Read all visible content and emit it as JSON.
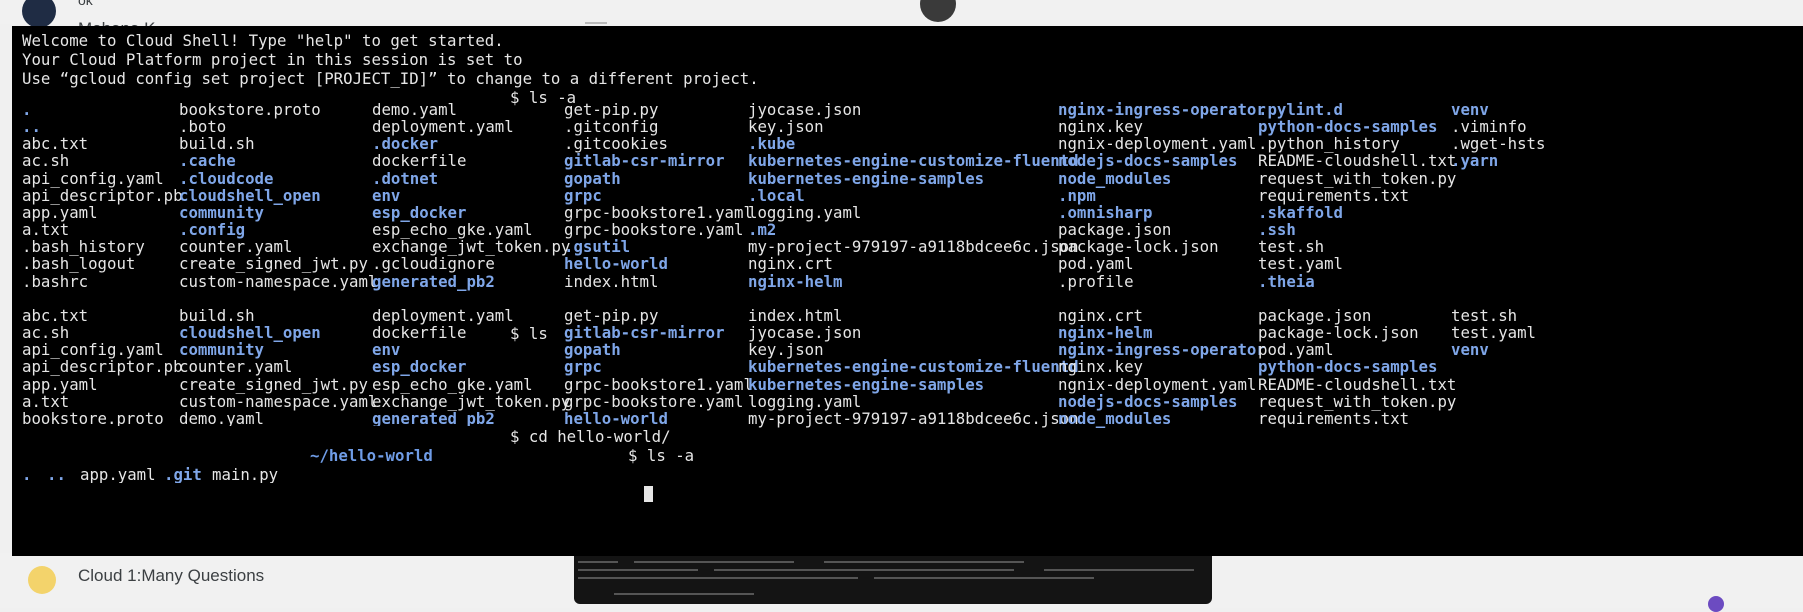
{
  "background": {
    "sender_initials": "ok",
    "sender_name": "Mohana K",
    "bottom_label": "Cloud 1:Many Questions"
  },
  "terminal": {
    "welcome": [
      "Welcome to Cloud Shell! Type \"help\" to get started.",
      "Your Cloud Platform project in this session is set to",
      "Use “gcloud config set project [PROJECT_ID]” to change to a different project."
    ],
    "commands": {
      "ls_a": "$ ls -a",
      "ls": "$ ls",
      "cd": "$ cd hello-world/",
      "ls_a2": "$ ls -a"
    },
    "prompt_path": "~/hello-world",
    "listing1": [
      [
        ".",
        "bookstore.proto",
        "demo.yaml",
        "get-pip.py",
        "jyocase.json",
        "nginx-ingress-operator",
        ".pylint.d",
        "venv"
      ],
      [
        "..",
        ".boto",
        "deployment.yaml",
        ".gitconfig",
        "key.json",
        "nginx.key",
        "python-docs-samples",
        ".viminfo"
      ],
      [
        "abc.txt",
        "build.sh",
        ".docker",
        ".gitcookies",
        ".kube",
        "ngnix-deployment.yaml",
        ".python_history",
        ".wget-hsts"
      ],
      [
        "ac.sh",
        ".cache",
        "dockerfile",
        "gitlab-csr-mirror",
        "kubernetes-engine-customize-fluentd",
        "nodejs-docs-samples",
        "README-cloudshell.txt",
        ".yarn"
      ],
      [
        "api_config.yaml",
        ".cloudcode",
        ".dotnet",
        "gopath",
        "kubernetes-engine-samples",
        "node_modules",
        "request_with_token.py",
        ""
      ],
      [
        "api_descriptor.pb",
        "cloudshell_open",
        "env",
        "grpc",
        ".local",
        ".npm",
        "requirements.txt",
        ""
      ],
      [
        "app.yaml",
        "community",
        "esp_docker",
        "grpc-bookstore1.yaml",
        "logging.yaml",
        ".omnisharp",
        ".skaffold",
        ""
      ],
      [
        "a.txt",
        ".config",
        "esp_echo_gke.yaml",
        "grpc-bookstore.yaml",
        ".m2",
        "package.json",
        ".ssh",
        ""
      ],
      [
        ".bash_history",
        "counter.yaml",
        "exchange_jwt_token.py",
        ".gsutil",
        "my-project-979197-a9118bdcee6c.json",
        "package-lock.json",
        "test.sh",
        ""
      ],
      [
        ".bash_logout",
        "create_signed_jwt.py",
        ".gcloudignore",
        "hello-world",
        "nginx.crt",
        "pod.yaml",
        "test.yaml",
        ""
      ],
      [
        ".bashrc",
        "custom-namespace.yaml",
        "generated_pb2",
        "index.html",
        "nginx-helm",
        ".profile",
        ".theia",
        ""
      ]
    ],
    "listing1_dirs": [
      [
        1,
        0,
        0,
        0,
        0,
        1,
        1,
        1
      ],
      [
        1,
        0,
        0,
        0,
        0,
        0,
        1,
        0
      ],
      [
        0,
        0,
        1,
        0,
        1,
        0,
        0,
        0
      ],
      [
        0,
        1,
        0,
        1,
        1,
        1,
        0,
        1
      ],
      [
        0,
        1,
        1,
        1,
        1,
        1,
        0,
        0
      ],
      [
        0,
        1,
        1,
        1,
        1,
        1,
        0,
        0
      ],
      [
        0,
        1,
        1,
        0,
        0,
        1,
        1,
        0
      ],
      [
        0,
        1,
        0,
        0,
        1,
        0,
        1,
        0
      ],
      [
        0,
        0,
        0,
        1,
        0,
        0,
        0,
        0
      ],
      [
        0,
        0,
        0,
        1,
        0,
        0,
        0,
        0
      ],
      [
        0,
        0,
        1,
        0,
        1,
        0,
        1,
        0
      ]
    ],
    "listing2": [
      [
        "abc.txt",
        "build.sh",
        "deployment.yaml",
        "get-pip.py",
        "index.html",
        "nginx.crt",
        "package.json",
        "test.sh"
      ],
      [
        "ac.sh",
        "cloudshell_open",
        "dockerfile",
        "gitlab-csr-mirror",
        "jyocase.json",
        "nginx-helm",
        "package-lock.json",
        "test.yaml"
      ],
      [
        "api_config.yaml",
        "community",
        "env",
        "gopath",
        "key.json",
        "nginx-ingress-operator",
        "pod.yaml",
        "venv"
      ],
      [
        "api_descriptor.pb",
        "counter.yaml",
        "esp_docker",
        "grpc",
        "kubernetes-engine-customize-fluentd",
        "nginx.key",
        "python-docs-samples",
        ""
      ],
      [
        "app.yaml",
        "create_signed_jwt.py",
        "esp_echo_gke.yaml",
        "grpc-bookstore1.yaml",
        "kubernetes-engine-samples",
        "ngnix-deployment.yaml",
        "README-cloudshell.txt",
        ""
      ],
      [
        "a.txt",
        "custom-namespace.yaml",
        "exchange_jwt_token.py",
        "grpc-bookstore.yaml",
        "logging.yaml",
        "nodejs-docs-samples",
        "request_with_token.py",
        ""
      ],
      [
        "bookstore.proto",
        "demo.yaml",
        "generated_pb2",
        "hello-world",
        "my-project-979197-a9118bdcee6c.json",
        "node_modules",
        "requirements.txt",
        ""
      ]
    ],
    "listing2_dirs": [
      [
        0,
        0,
        0,
        0,
        0,
        0,
        0,
        0
      ],
      [
        0,
        1,
        0,
        1,
        0,
        1,
        0,
        0
      ],
      [
        0,
        1,
        1,
        1,
        0,
        1,
        0,
        1
      ],
      [
        0,
        0,
        1,
        1,
        1,
        0,
        1,
        0
      ],
      [
        0,
        0,
        0,
        0,
        1,
        0,
        0,
        0
      ],
      [
        0,
        0,
        0,
        0,
        0,
        1,
        0,
        0
      ],
      [
        0,
        0,
        1,
        1,
        0,
        1,
        0,
        0
      ]
    ],
    "listing3": [
      {
        "name": ".",
        "dir": true
      },
      {
        "name": "..",
        "dir": true
      },
      {
        "name": "app.yaml",
        "dir": false
      },
      {
        "name": ".git",
        "dir": true
      },
      {
        "name": "main.py",
        "dir": false
      }
    ]
  }
}
